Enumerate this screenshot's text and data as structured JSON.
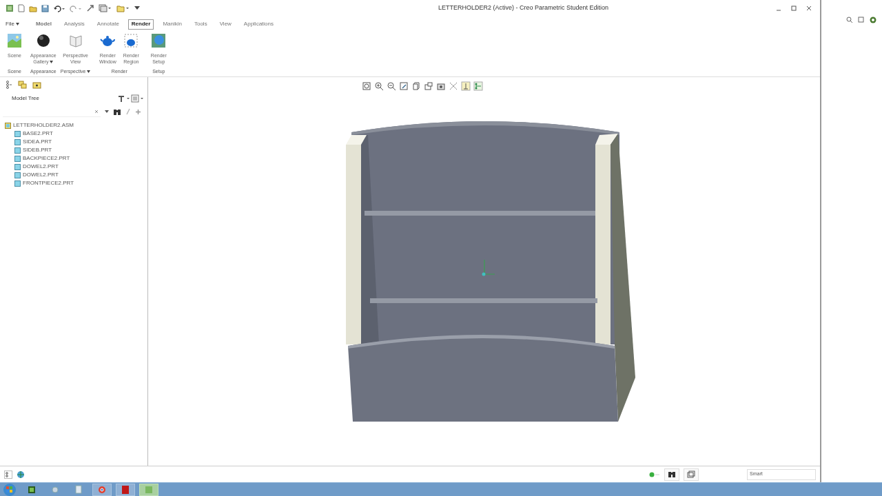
{
  "window": {
    "title": "LETTERHOLDER2 (Active) - Creo Parametric Student Edition"
  },
  "file_menu": {
    "label": "File"
  },
  "tabs": [
    {
      "label": "Model",
      "selected": false
    },
    {
      "label": "Analysis",
      "selected": false
    },
    {
      "label": "Annotate",
      "selected": false
    },
    {
      "label": "Render",
      "selected": true
    },
    {
      "label": "Manikin",
      "selected": false
    },
    {
      "label": "Tools",
      "selected": false
    },
    {
      "label": "View",
      "selected": false
    },
    {
      "label": "Applications",
      "selected": false
    }
  ],
  "ribbon_groups": [
    {
      "label": "Scene",
      "dropdown": false,
      "buttons": [
        {
          "label": "Scene",
          "dropdown": false
        }
      ]
    },
    {
      "label": "Appearance",
      "dropdown": false,
      "buttons": [
        {
          "label": "Appearance Gallery",
          "dropdown": true
        }
      ]
    },
    {
      "label": "Perspective",
      "dropdown": true,
      "buttons": [
        {
          "label": "Perspective View",
          "dropdown": false
        }
      ]
    },
    {
      "label": "Render",
      "dropdown": false,
      "buttons": [
        {
          "label": "Render Window",
          "dropdown": false
        },
        {
          "label": "Render Region",
          "dropdown": false
        }
      ]
    },
    {
      "label": "Setup",
      "dropdown": false,
      "buttons": [
        {
          "label": "Render Setup",
          "dropdown": false
        }
      ]
    }
  ],
  "model_tree": {
    "title": "Model Tree",
    "items": [
      {
        "label": "LETTERHOLDER2.ASM",
        "kind": "assembly",
        "children": [
          {
            "label": "BASE2.PRT",
            "kind": "part"
          },
          {
            "label": "SIDEA.PRT",
            "kind": "part"
          },
          {
            "label": "SIDEB.PRT",
            "kind": "part"
          },
          {
            "label": "BACKPIECE2.PRT",
            "kind": "part"
          },
          {
            "label": "DOWEL2.PRT",
            "kind": "part"
          },
          {
            "label": "DOWEL2.PRT",
            "kind": "part"
          },
          {
            "label": "FRONTPIECE2.PRT",
            "kind": "part"
          }
        ]
      }
    ]
  },
  "status_bar": {
    "filter": "Smart"
  }
}
